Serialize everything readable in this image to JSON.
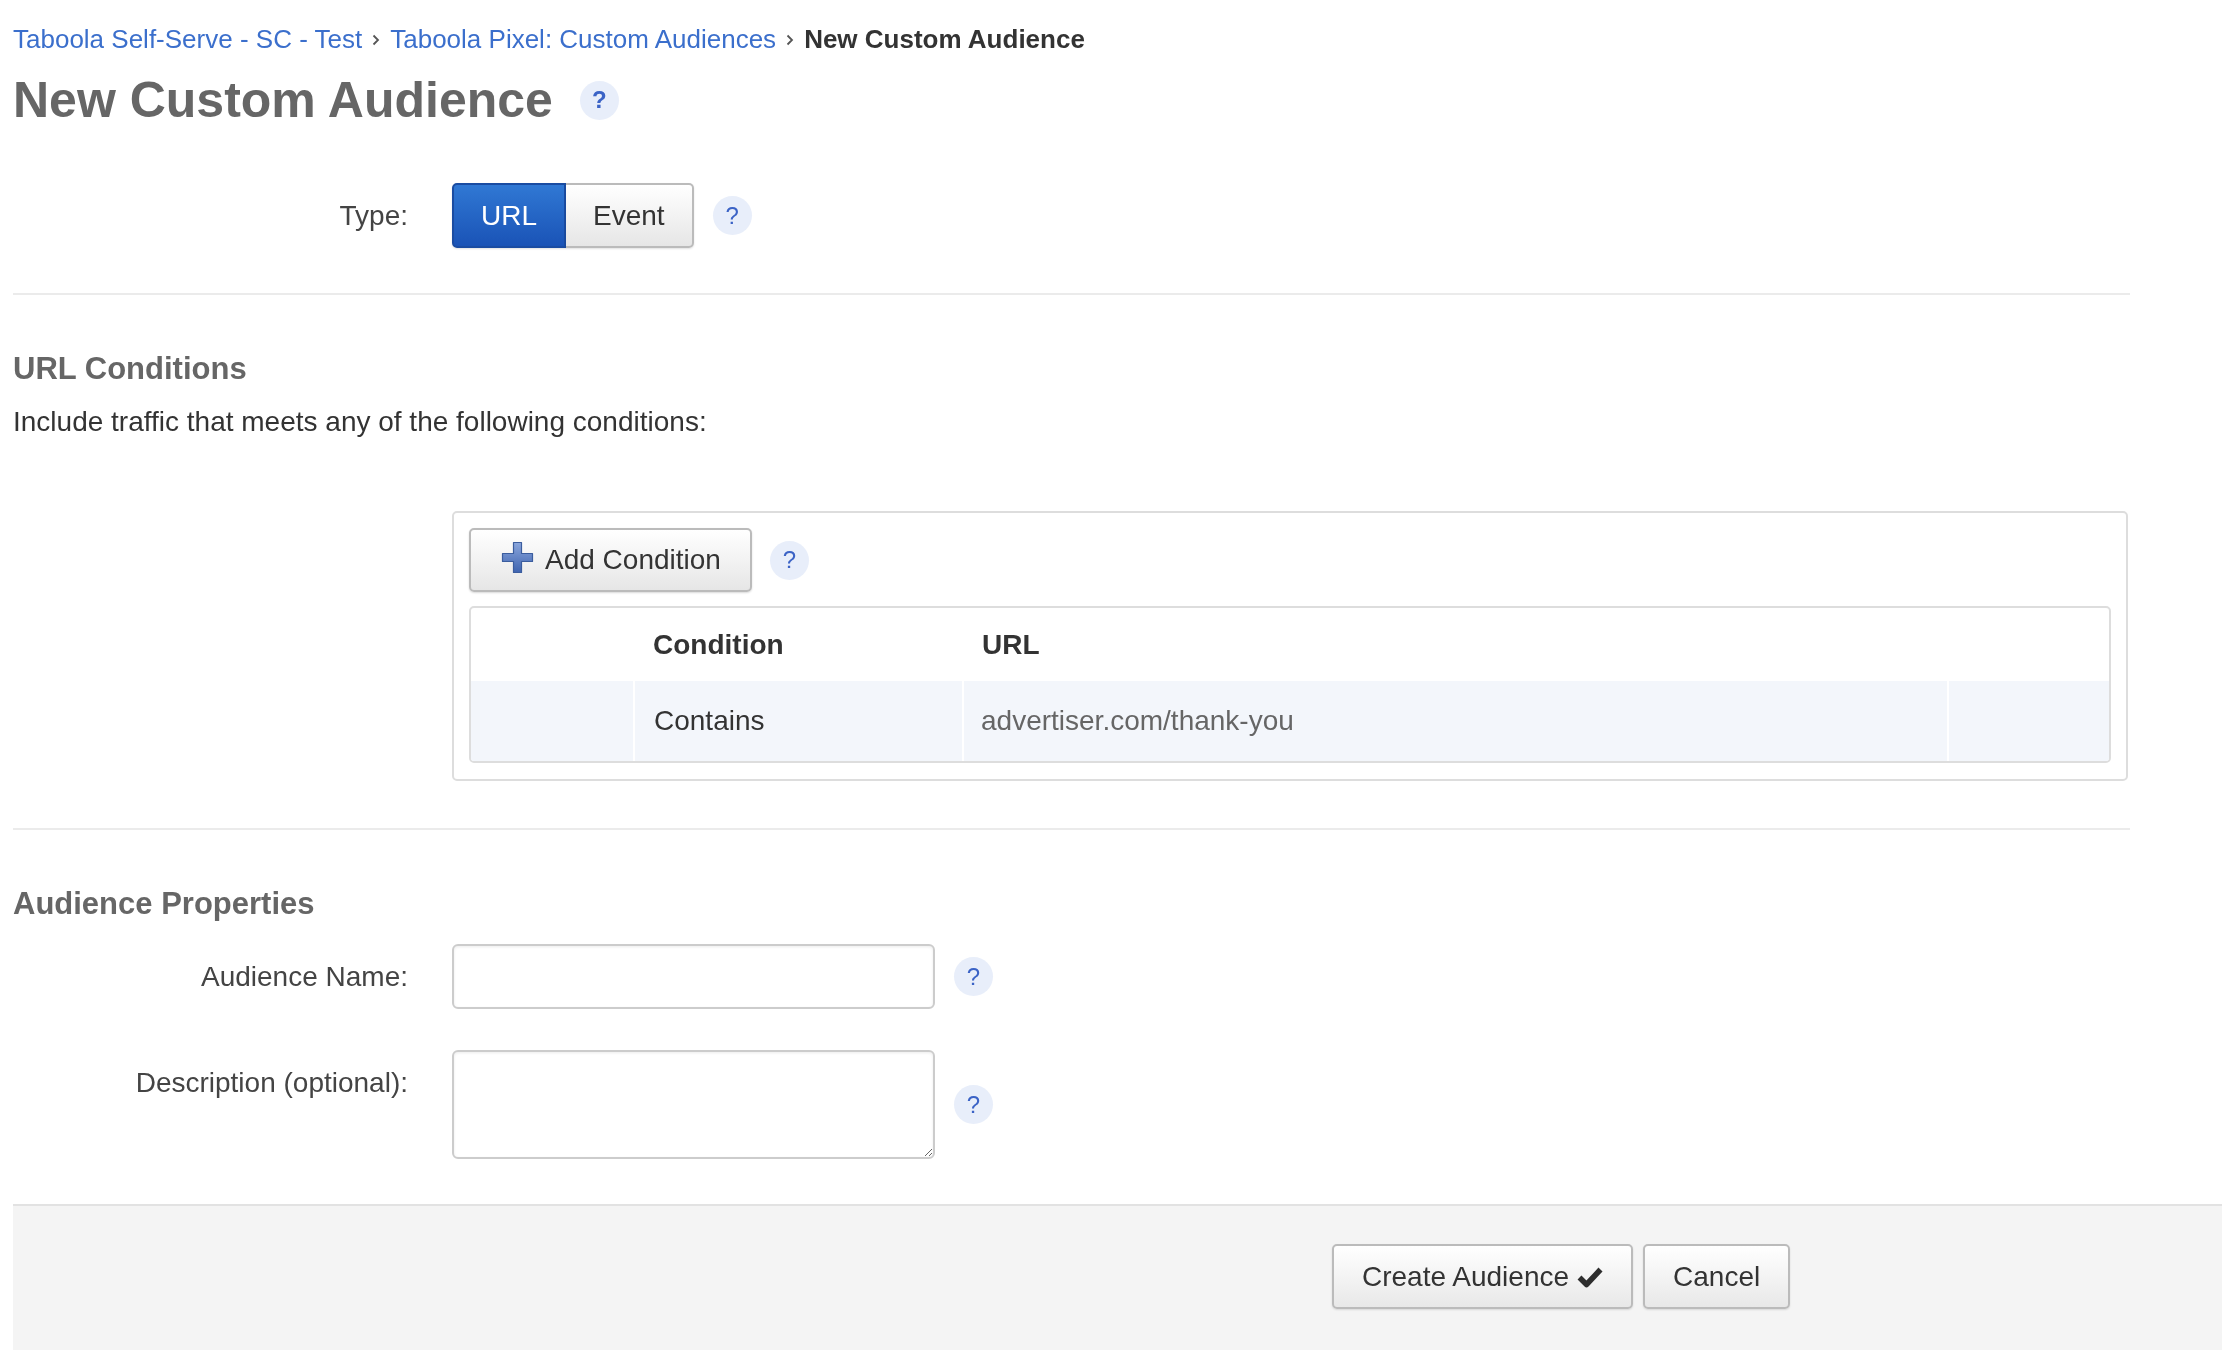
{
  "breadcrumb": [
    {
      "label": "Taboola Self-Serve - SC - Test",
      "current": false
    },
    {
      "label": "Taboola Pixel: Custom Audiences",
      "current": false
    },
    {
      "label": "New Custom Audience",
      "current": true
    }
  ],
  "page_title": {
    "text": "New Custom Audience",
    "help": "?"
  },
  "type_field": {
    "label": "Type:",
    "options": [
      {
        "label": "URL",
        "selected": true
      },
      {
        "label": "Event",
        "selected": false
      }
    ],
    "help": "?"
  },
  "url_conditions": {
    "heading": "URL Conditions",
    "description": "Include traffic that meets any of the following conditions:",
    "add_button": {
      "label": "Add Condition",
      "help": "?"
    },
    "table": {
      "columns": [
        "Condition",
        "URL"
      ],
      "rows": [
        [
          "Contains",
          "advertiser.com/thank-you"
        ]
      ]
    }
  },
  "audience_properties": {
    "heading": "Audience Properties",
    "fields": [
      {
        "kind": "text",
        "label": "Audience Name:",
        "help": "?"
      },
      {
        "kind": "textarea",
        "label": "Description (optional):",
        "help": "?"
      }
    ]
  },
  "footer": {
    "buttons": [
      {
        "kind": "confirm",
        "label": "Create Audience"
      },
      {
        "kind": "cancel",
        "label": "Cancel"
      }
    ]
  }
}
